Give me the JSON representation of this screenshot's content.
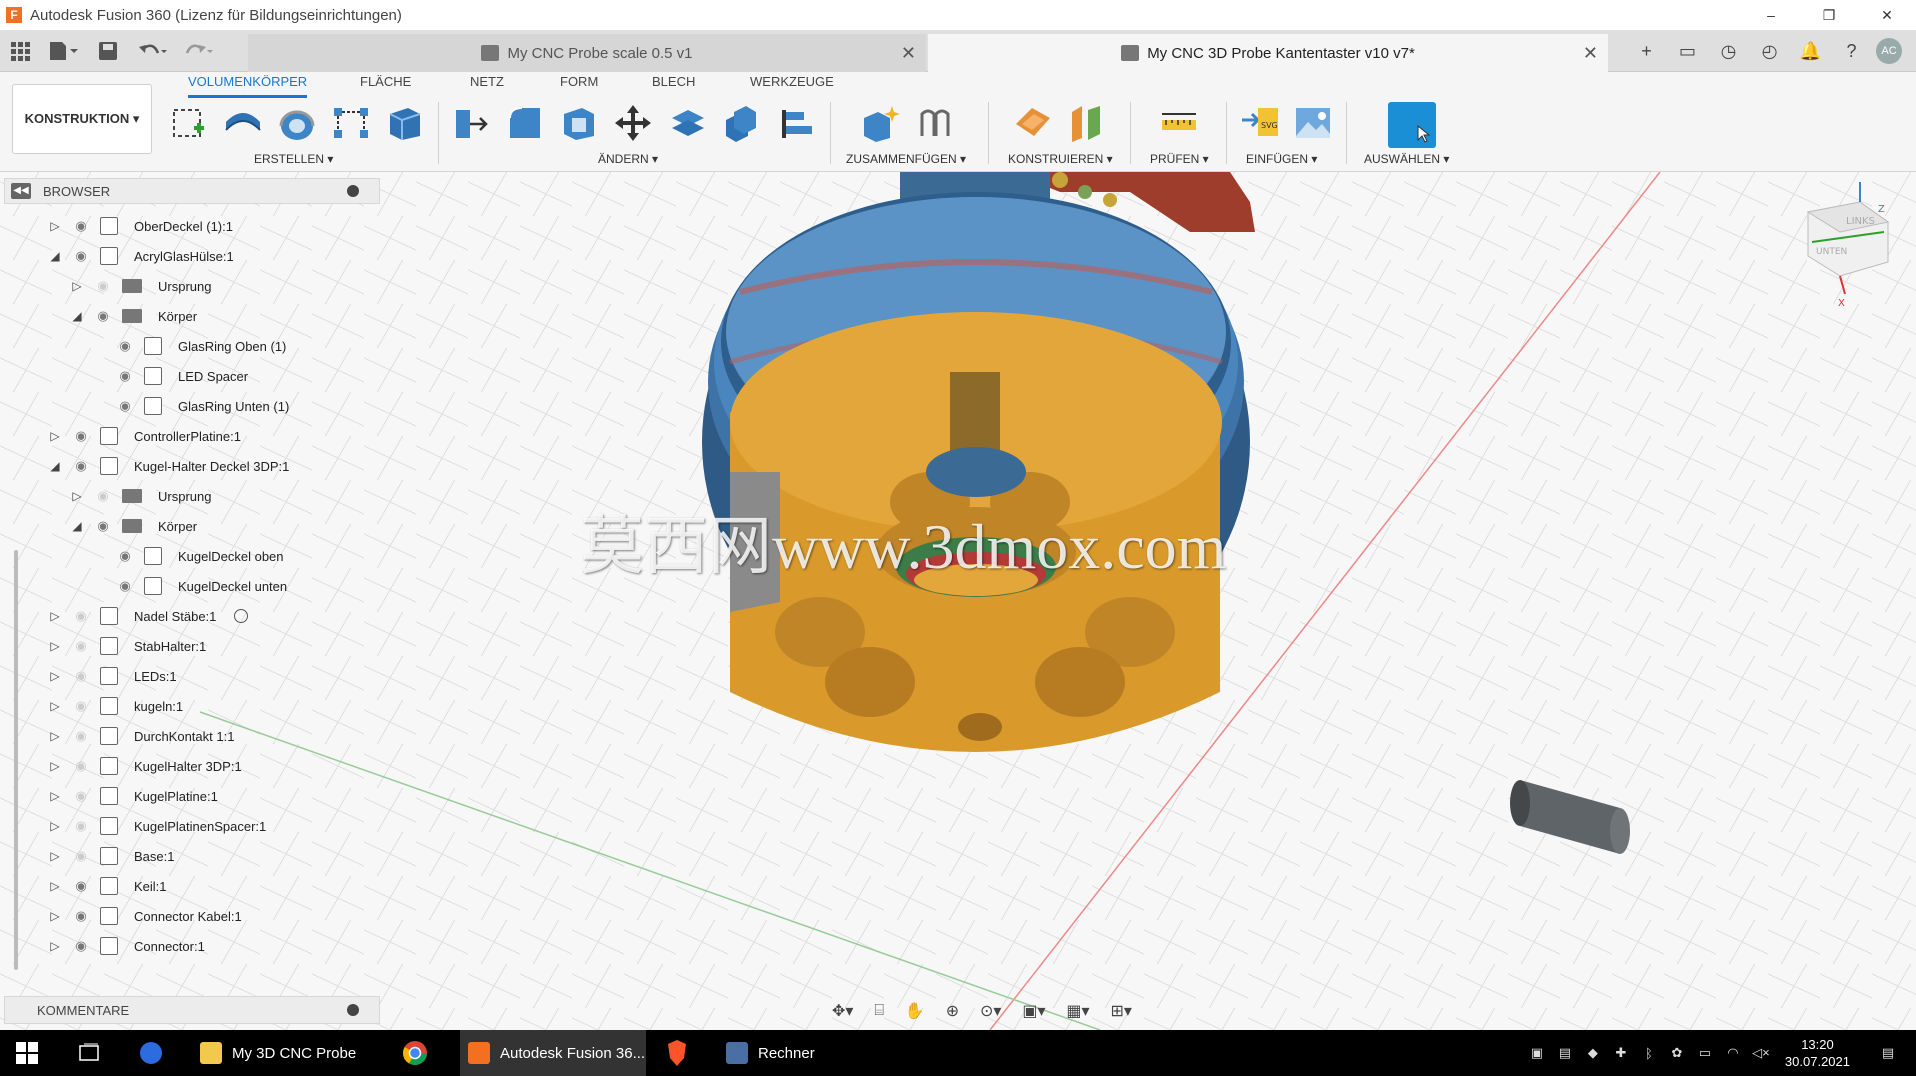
{
  "window": {
    "title": "Autodesk Fusion 360 (Lizenz für Bildungseinrichtungen)",
    "app_icon_letter": "F",
    "controls": [
      "–",
      "❐",
      "✕"
    ]
  },
  "doc_tabs": [
    {
      "label": "My CNC Probe scale 0.5 v1",
      "active": false
    },
    {
      "label": "My CNC 3D Probe Kantentaster v10 v7*",
      "active": true
    }
  ],
  "quick_access": {
    "grid_icon": "grid-icon",
    "file_icon": "file-icon",
    "save_icon": "save-icon",
    "undo_icon": "undo-icon",
    "redo_icon": "redo-icon"
  },
  "right_icons": {
    "add": "+",
    "chat": "▭",
    "sync": "◷",
    "history": "◴",
    "bell": "🔔",
    "help": "?",
    "avatar": "AC"
  },
  "ribbon": {
    "workspace": "KONSTRUKTION ▾",
    "tabs": [
      "VOLUMENKÖRPER",
      "FLÄCHE",
      "NETZ",
      "FORM",
      "BLECH",
      "WERKZEUGE"
    ],
    "active_tab": "VOLUMENKÖRPER",
    "groups": [
      {
        "label": "ERSTELLEN ▾"
      },
      {
        "label": "ÄNDERN ▾"
      },
      {
        "label": "ZUSAMMENFÜGEN ▾"
      },
      {
        "label": "KONSTRUIEREN ▾"
      },
      {
        "label": "PRÜFEN ▾"
      },
      {
        "label": "EINFÜGEN ▾"
      },
      {
        "label": "AUSWÄHLEN ▾"
      }
    ]
  },
  "browser": {
    "title": "BROWSER",
    "collapse": "◀◀",
    "rows": [
      {
        "label": "OberDeckel (1):1",
        "expanded": false,
        "visible": true,
        "type": "component",
        "indent": 0
      },
      {
        "label": "AcrylGlasHülse:1",
        "expanded": true,
        "visible": true,
        "type": "component",
        "indent": 0
      },
      {
        "label": "Ursprung",
        "expanded": false,
        "visible": false,
        "type": "folder",
        "indent": 1
      },
      {
        "label": "Körper",
        "expanded": true,
        "visible": true,
        "type": "folder",
        "indent": 1
      },
      {
        "label": "GlasRing Oben (1)",
        "expanded": null,
        "visible": true,
        "type": "body",
        "indent": 2
      },
      {
        "label": "LED Spacer",
        "expanded": null,
        "visible": true,
        "type": "body",
        "indent": 2
      },
      {
        "label": "GlasRing Unten (1)",
        "expanded": null,
        "visible": true,
        "type": "body",
        "indent": 2
      },
      {
        "label": "ControllerPlatine:1",
        "expanded": false,
        "visible": true,
        "type": "component",
        "indent": 0
      },
      {
        "label": "Kugel-Halter Deckel 3DP:1",
        "expanded": true,
        "visible": true,
        "type": "component",
        "indent": 0
      },
      {
        "label": "Ursprung",
        "expanded": false,
        "visible": false,
        "type": "folder",
        "indent": 1
      },
      {
        "label": "Körper",
        "expanded": true,
        "visible": true,
        "type": "folder",
        "indent": 1
      },
      {
        "label": "KugelDeckel oben",
        "expanded": null,
        "visible": true,
        "type": "body",
        "indent": 2
      },
      {
        "label": "KugelDeckel unten",
        "expanded": null,
        "visible": true,
        "type": "body",
        "indent": 2
      },
      {
        "label": "Nadel Stäbe:1",
        "expanded": false,
        "visible": false,
        "type": "component",
        "indent": 0,
        "marker": true
      },
      {
        "label": "StabHalter:1",
        "expanded": false,
        "visible": false,
        "type": "component",
        "indent": 0
      },
      {
        "label": "LEDs:1",
        "expanded": false,
        "visible": false,
        "type": "component",
        "indent": 0
      },
      {
        "label": "kugeln:1",
        "expanded": false,
        "visible": false,
        "type": "component",
        "indent": 0
      },
      {
        "label": "DurchKontakt 1:1",
        "expanded": false,
        "visible": false,
        "type": "component",
        "indent": 0
      },
      {
        "label": "KugelHalter 3DP:1",
        "expanded": false,
        "visible": false,
        "type": "component",
        "indent": 0
      },
      {
        "label": "KugelPlatine:1",
        "expanded": false,
        "visible": false,
        "type": "component",
        "indent": 0
      },
      {
        "label": "KugelPlatinenSpacer:1",
        "expanded": false,
        "visible": false,
        "type": "component",
        "indent": 0
      },
      {
        "label": "Base:1",
        "expanded": false,
        "visible": false,
        "type": "component",
        "indent": 0
      },
      {
        "label": "Keil:1",
        "expanded": false,
        "visible": true,
        "type": "component",
        "indent": 0
      },
      {
        "label": "Connector Kabel:1",
        "expanded": false,
        "visible": true,
        "type": "component",
        "indent": 0
      },
      {
        "label": "Connector:1",
        "expanded": false,
        "visible": true,
        "type": "component",
        "indent": 0
      }
    ]
  },
  "comments": {
    "title": "KOMMENTARE"
  },
  "viewcube": {
    "face_top": "LINKS",
    "face_side": "UNTEN",
    "axis_x": "X",
    "axis_z": "Z"
  },
  "watermark": "莫西网www.3dmox.com",
  "navbar": {
    "icons": [
      "orbit-icon",
      "look-at-icon",
      "pan-icon",
      "zoom-icon",
      "fit-icon",
      "display-settings-icon",
      "grid-settings-icon",
      "viewports-icon"
    ]
  },
  "taskbar": {
    "items": [
      {
        "label": ""
      },
      {
        "label": ""
      },
      {
        "label": ""
      },
      {
        "label": "My 3D CNC Probe"
      },
      {
        "label": ""
      },
      {
        "label": "Autodesk Fusion 36..."
      },
      {
        "label": ""
      },
      {
        "label": "Rechner"
      }
    ],
    "time": "13:20",
    "date": "30.07.2021"
  },
  "colors": {
    "accent": "#1976d2",
    "select_button": "#1a8fd6",
    "part_orange": "#e3a63a",
    "part_blue": "#3f6f9a",
    "part_red": "#a84a30"
  }
}
